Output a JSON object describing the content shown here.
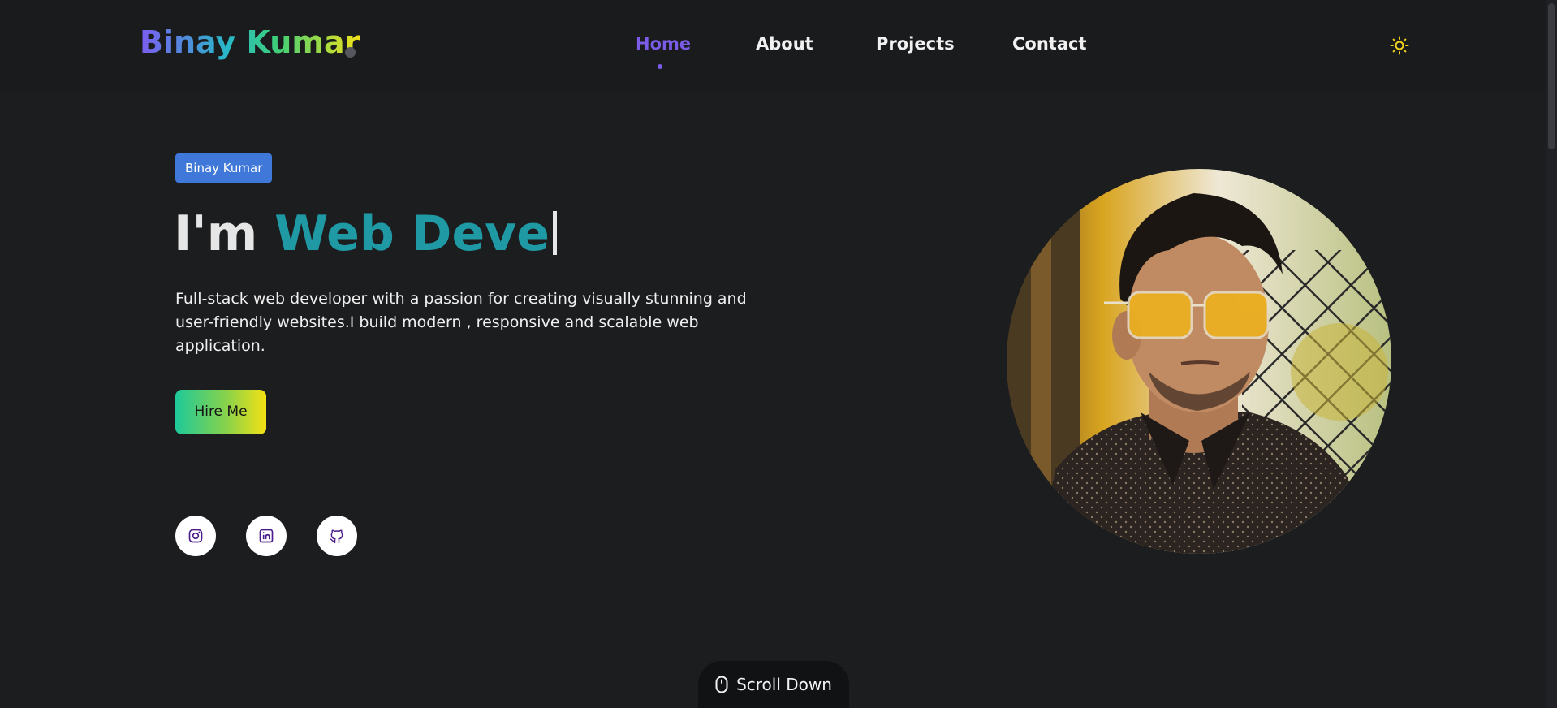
{
  "header": {
    "logo": "Binay Kumar",
    "nav": [
      {
        "label": "Home",
        "active": true
      },
      {
        "label": "About",
        "active": false
      },
      {
        "label": "Projects",
        "active": false
      },
      {
        "label": "Contact",
        "active": false
      }
    ],
    "theme_toggle_icon": "sun-icon"
  },
  "hero": {
    "badge": "Binay Kumar",
    "headline_prefix": "I'm",
    "headline_role": "Web Deve",
    "description": "Full-stack web developer with a passion for creating visually stunning and user-friendly websites.I build modern , responsive and scalable web application.",
    "hire_button": "Hire Me",
    "socials": [
      "instagram-icon",
      "linkedin-icon",
      "github-icon"
    ]
  },
  "scroll_down": {
    "label": "Scroll Down",
    "icon": "mouse-icon"
  },
  "colors": {
    "background": "#1c1d1f",
    "accent": "#7a5ce6",
    "role_text": "#1f9aa5",
    "badge": "#3f78d8"
  }
}
